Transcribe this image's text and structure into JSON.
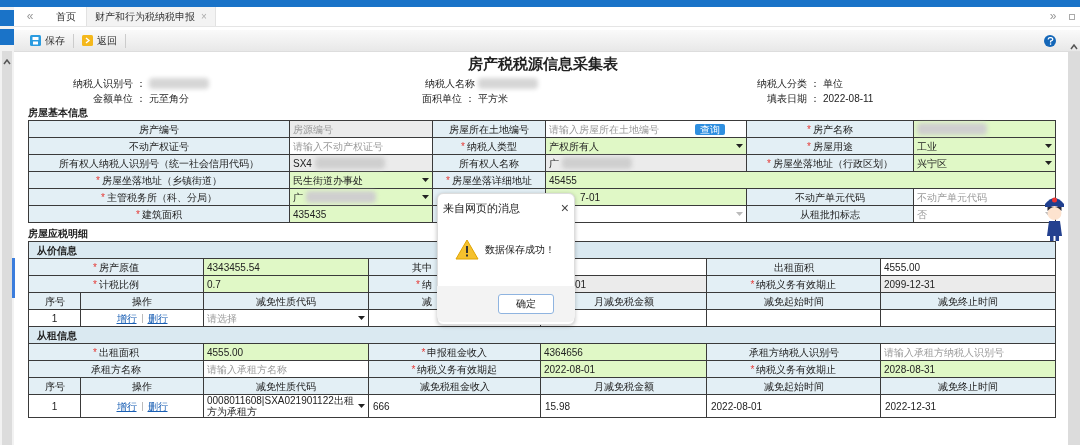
{
  "tab_strip": {
    "left": "«",
    "right": "»"
  },
  "tabs": [
    {
      "label": "首页",
      "selected": false
    },
    {
      "label": "财产和行为税纳税申报",
      "selected": true,
      "close": "×"
    }
  ],
  "toolbar": [
    {
      "label": "保存",
      "kind": "save"
    },
    {
      "label": "返回",
      "kind": "back"
    }
  ],
  "form": {
    "title": "房产税税源信息采集表",
    "info": [
      {
        "label": "纳税人识别号 ：",
        "redacted": true
      },
      {
        "label": "纳税人名称",
        "redacted": true
      },
      {
        "label": "纳税人分类 ：",
        "value": "单位"
      },
      {
        "label": "金额单位 ：",
        "value": "元至角分"
      },
      {
        "label": "面积单位 ：",
        "value": "平方米"
      },
      {
        "label": "填表日期 ：",
        "value": "2022-08-11"
      }
    ],
    "sections": [
      {
        "title": "房屋基本信息",
        "table": {
          "rows": [
            {
              "kind": "fields",
              "cells": [
                {
                  "kind": "label",
                  "text": "房产编号"
                },
                {
                  "kind": "value",
                  "placeholder": "房源编号",
                  "readonly": true
                },
                {
                  "kind": "label",
                  "text": "房屋所在土地编号"
                },
                {
                  "kind": "value",
                  "placeholder": "请输入房屋所在土地编号",
                  "button": "查询"
                },
                {
                  "kind": "label",
                  "mark": "*",
                  "text": "房产名称"
                },
                {
                  "kind": "value",
                  "required": true,
                  "redacted": true
                }
              ]
            },
            {
              "kind": "fields",
              "cells": [
                {
                  "kind": "label",
                  "text": "不动产权证号"
                },
                {
                  "kind": "value",
                  "placeholder": "请输入不动产权证号"
                },
                {
                  "kind": "label",
                  "mark": "*",
                  "text": "纳税人类型"
                },
                {
                  "kind": "value",
                  "text": "产权所有人",
                  "required": true,
                  "dropdown": true
                },
                {
                  "kind": "label",
                  "mark": "*",
                  "text": "房屋用途"
                },
                {
                  "kind": "value",
                  "text": "工业",
                  "required": true,
                  "dropdown": true
                }
              ]
            },
            {
              "kind": "fields",
              "cells": [
                {
                  "kind": "label",
                  "text": "所有权人纳税人识别号（统一社会信用代码）"
                },
                {
                  "kind": "value",
                  "text": "SX4",
                  "readonly": true,
                  "redacted": true
                },
                {
                  "kind": "label",
                  "text": "所有权人名称"
                },
                {
                  "kind": "value",
                  "text": "广",
                  "readonly": true,
                  "redacted": true
                },
                {
                  "kind": "label",
                  "mark": "*",
                  "text": "房屋坐落地址（行政区划）"
                },
                {
                  "kind": "value",
                  "text": "兴宁区",
                  "required": true,
                  "dropdown": true
                }
              ]
            },
            {
              "kind": "fields",
              "cells": [
                {
                  "kind": "label",
                  "mark": "*",
                  "text": "房屋坐落地址（乡镇街道）"
                },
                {
                  "kind": "value",
                  "text": "民生街道办事处",
                  "required": true,
                  "dropdown": true
                },
                {
                  "kind": "label",
                  "mark": "*",
                  "text": "房屋坐落详细地址"
                },
                {
                  "kind": "value",
                  "text": "45455",
                  "required": true,
                  "wide": true
                }
              ]
            },
            {
              "kind": "fields",
              "cells": [
                {
                  "kind": "label",
                  "mark": "*",
                  "text": "主管税务所（科、分局）"
                },
                {
                  "kind": "value",
                  "text": "广",
                  "required": true,
                  "dropdown": true,
                  "redacted": true
                },
                {
                  "kind": "label"
                },
                {
                  "kind": "value",
                  "text": "7-01",
                  "required": true,
                  "cut_left": true
                },
                {
                  "kind": "label",
                  "text": "不动产单元代码"
                },
                {
                  "kind": "value",
                  "placeholder": "不动产单元代码"
                }
              ]
            },
            {
              "kind": "fields",
              "cells": [
                {
                  "kind": "label",
                  "mark": "*",
                  "text": "建筑面积"
                },
                {
                  "kind": "value",
                  "text": "435435",
                  "required": true
                },
                {
                  "kind": "label"
                },
                {
                  "kind": "value",
                  "dropdown": true,
                  "disabled": true
                },
                {
                  "kind": "label",
                  "text": "从租批扣标志"
                },
                {
                  "kind": "value",
                  "text": "否",
                  "dropdown": true,
                  "disabled": true
                }
              ]
            }
          ]
        }
      },
      {
        "title": "房屋应税明细",
        "table": {
          "rows": [
            {
              "kind": "group",
              "text": "从价信息"
            },
            {
              "kind": "fields",
              "cells": [
                {
                  "kind": "label",
                  "mark": "*",
                  "text": "房产原值",
                  "wide": true
                },
                {
                  "kind": "value",
                  "text": "4343455.54",
                  "required": true
                },
                {
                  "kind": "label",
                  "text": "其中",
                  "cut_right": true
                },
                {
                  "kind": "value"
                },
                {
                  "kind": "label",
                  "text": "出租面积"
                },
                {
                  "kind": "value",
                  "text": "4555.00"
                }
              ]
            },
            {
              "kind": "fields",
              "cells": [
                {
                  "kind": "label",
                  "mark": "*",
                  "text": "计税比例",
                  "wide": true
                },
                {
                  "kind": "value",
                  "text": "0.7",
                  "required": true
                },
                {
                  "kind": "label",
                  "mark": "*",
                  "text": "纳",
                  "cut_right": true
                },
                {
                  "kind": "value",
                  "text": "01",
                  "readonly": true,
                  "cut_left": true
                },
                {
                  "kind": "label",
                  "mark": "*",
                  "text": "纳税义务有效期止"
                },
                {
                  "kind": "value",
                  "text": "2099-12-31",
                  "readonly": true
                }
              ]
            },
            {
              "kind": "header",
              "cells": [
                {
                  "text": "序号"
                },
                {
                  "text": "操作"
                },
                {
                  "text": "减免性质代码"
                },
                {
                  "text": "减",
                  "cut_right": true
                },
                {
                  "text": "月减免税金额"
                },
                {
                  "text": "减免起始时间"
                },
                {
                  "text": "减免终止时间"
                }
              ]
            },
            {
              "kind": "detail",
              "cells": [
                {
                  "kind": "text",
                  "text": "1"
                },
                {
                  "kind": "actions",
                  "links": [
                    "增行",
                    "删行"
                  ]
                },
                {
                  "kind": "value",
                  "placeholder": "请选择",
                  "dropdown": true
                },
                {
                  "kind": "text"
                },
                {
                  "kind": "text"
                },
                {
                  "kind": "text"
                },
                {
                  "kind": "text"
                }
              ]
            },
            {
              "kind": "group",
              "text": "从租信息"
            },
            {
              "kind": "fields",
              "cells": [
                {
                  "kind": "label",
                  "mark": "*",
                  "text": "出租面积",
                  "wide": true
                },
                {
                  "kind": "value",
                  "text": "4555.00",
                  "required": true
                },
                {
                  "kind": "label",
                  "mark": "*",
                  "text": "申报租金收入"
                },
                {
                  "kind": "value",
                  "text": "4364656",
                  "required": true
                },
                {
                  "kind": "label",
                  "text": "承租方纳税人识别号"
                },
                {
                  "kind": "value",
                  "placeholder": "请输入承租方纳税人识别号"
                }
              ]
            },
            {
              "kind": "fields",
              "cells": [
                {
                  "kind": "label",
                  "text": "承租方名称",
                  "wide": true
                },
                {
                  "kind": "value",
                  "placeholder": "请输入承租方名称"
                },
                {
                  "kind": "label",
                  "mark": "*",
                  "text": "纳税义务有效期起"
                },
                {
                  "kind": "value",
                  "text": "2022-08-01",
                  "required": true
                },
                {
                  "kind": "label",
                  "mark": "*",
                  "text": "纳税义务有效期止"
                },
                {
                  "kind": "value",
                  "text": "2028-08-31",
                  "required": true
                }
              ]
            },
            {
              "kind": "header",
              "cells": [
                {
                  "text": "序号"
                },
                {
                  "text": "操作"
                },
                {
                  "text": "减免性质代码"
                },
                {
                  "text": "减免税租金收入"
                },
                {
                  "text": "月减免税金额"
                },
                {
                  "text": "减免起始时间"
                },
                {
                  "text": "减免终止时间"
                }
              ]
            },
            {
              "kind": "detail",
              "cells": [
                {
                  "kind": "text",
                  "text": "1"
                },
                {
                  "kind": "actions",
                  "links": [
                    "增行",
                    "删行"
                  ]
                },
                {
                  "kind": "value",
                  "text": "0008011608|SXA021901122出租方为承租方",
                  "dropdown": true
                },
                {
                  "kind": "text",
                  "text": "666"
                },
                {
                  "kind": "text",
                  "text": "15.98"
                },
                {
                  "kind": "text",
                  "text": "2022-08-01"
                },
                {
                  "kind": "text",
                  "text": "2022-12-31"
                }
              ]
            }
          ]
        }
      }
    ]
  },
  "dialog": {
    "title": "来自网页的消息",
    "close": "×",
    "message": "数据保存成功！",
    "button": "确定"
  }
}
